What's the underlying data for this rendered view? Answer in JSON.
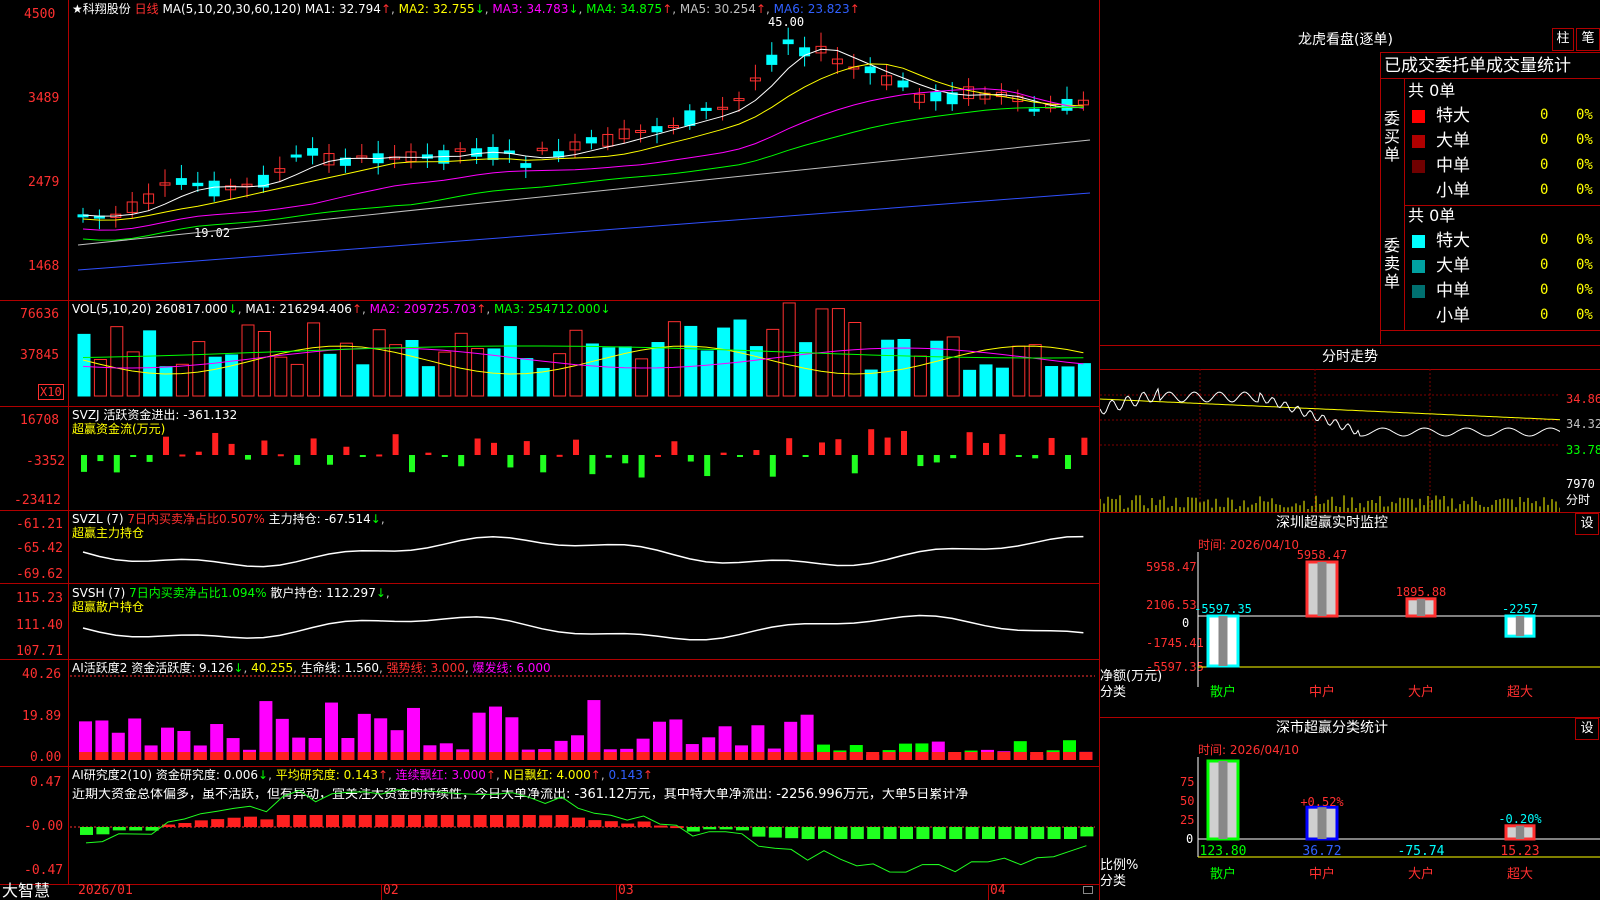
{
  "colors": {
    "up": "#ff3030",
    "down": "#00ffff",
    "grid": "#b00000",
    "ma1": "#ffffff",
    "ma2": "#ffff00",
    "ma3": "#ff00ff",
    "ma4": "#00ff00",
    "ma5": "#c0c0c0",
    "ma6": "#0000ff"
  },
  "main": {
    "star_name": "★科翔股份",
    "period": "日线",
    "ma_label": "MA(5,10,20,30,60,120)",
    "ma1": "MA1: 32.794",
    "ma2": "MA2: 32.755",
    "ma3": "MA3: 34.783",
    "ma4": "MA4: 34.875",
    "ma5": "MA5: 30.254",
    "ma6": "MA6: 23.823",
    "high_mark": "45.00",
    "low_mark": "19.02",
    "yaxis": [
      "4500",
      "3489",
      "2479",
      "1468"
    ]
  },
  "vol": {
    "title": "VOL(5,10,20)",
    "val": "260817.000",
    "ma1": "MA1: 216294.406",
    "ma2": "MA2: 209725.703",
    "ma3": "MA3: 254712.000",
    "yaxis": [
      "76636",
      "37845"
    ],
    "unit": "X10"
  },
  "svzj": {
    "line1": "SVZJ  活跃资金进出: -361.132",
    "line2": "超赢资金流(万元)",
    "yaxis": [
      "16708",
      "-3352",
      "-23412"
    ]
  },
  "svzl": {
    "l1": "SVZL (7)",
    "l2": "7日内买卖净占比0.507%",
    "l3": "主力持仓: -67.514",
    "line2": "超赢主力持仓",
    "yaxis": [
      "-61.21",
      "-65.42",
      "-69.62"
    ]
  },
  "svsh": {
    "l1": "SVSH (7)",
    "l2": "7日内买卖净占比1.094%",
    "l3": "散户持仓: 112.297",
    "line2": "超赢散户持仓",
    "yaxis": [
      "115.23",
      "111.40",
      "107.71"
    ]
  },
  "ai1": {
    "l1": "AI活跃度2 资金活跃度: 9.126",
    "l2": "40.255",
    "l3": "生命线: 1.560",
    "l4": "强势线: 3.000",
    "l5": "爆发线: 6.000",
    "yaxis": [
      "40.26",
      "19.89",
      "0.00"
    ]
  },
  "ai2": {
    "l1": "AI研究度2(10) 资金研究度: 0.006",
    "l2": "平均研究度: 0.143",
    "l3": "连续飘红: 3.000",
    "l4": "N日飘红: 4.000",
    "l5": "0.143",
    "comment": "近期大资金总体偏多，虽不活跃，但有异动，宜关注大资金的持续性，今日大单净流出: -361.12万元，其中特大单净流出: -2256.996万元，大单5日累计净",
    "yaxis": [
      "0.47",
      "-0.00",
      "-0.47"
    ]
  },
  "bottom": {
    "brand": "大智慧",
    "dates": [
      "2026/01",
      "02",
      "03",
      "04"
    ]
  },
  "lhkp": {
    "title": "龙虎看盘(逐单)",
    "btn_col": "柱",
    "btn_pen": "笔",
    "header": "已成交委托单成交量统计",
    "buy_label": "委买单",
    "sell_label": "委卖单",
    "buy_total": "共 0单",
    "sell_total": "共 0单",
    "buy_rows": [
      {
        "name": "特大",
        "val": "0",
        "pct": "0%",
        "color": "#ff0000"
      },
      {
        "name": "大单",
        "val": "0",
        "pct": "0%",
        "color": "#b00000"
      },
      {
        "name": "中单",
        "val": "0",
        "pct": "0%",
        "color": "#700000"
      },
      {
        "name": "小单",
        "val": "0",
        "pct": "0%",
        "color": "#000000"
      }
    ],
    "sell_rows": [
      {
        "name": "特大",
        "val": "0",
        "pct": "0%",
        "color": "#00ffff"
      },
      {
        "name": "大单",
        "val": "0",
        "pct": "0%",
        "color": "#00a0a0"
      },
      {
        "name": "中单",
        "val": "0",
        "pct": "0%",
        "color": "#007070"
      },
      {
        "name": "小单",
        "val": "0",
        "pct": "0%",
        "color": "#000000"
      }
    ]
  },
  "intraday": {
    "title": "分时走势",
    "yaxis": [
      "34.86",
      "34.32",
      "33.78"
    ],
    "vol_label": "7970",
    "fen": "分时"
  },
  "monitor": {
    "title": "深圳超赢实时监控",
    "btn": "设",
    "time": "时间: 2026/04/10",
    "yaxis": [
      "5958.47",
      "2106.53",
      "0",
      "-1745.41",
      "-5597.35"
    ],
    "ylabel": "净额(万元)",
    "xlabel": "分类",
    "categories": [
      "散户",
      "中户",
      "大户",
      "超大"
    ],
    "value_labels": [
      "-5597.35",
      "5958.47",
      "1895.88",
      "-2257"
    ]
  },
  "classify": {
    "title": "深市超赢分类统计",
    "btn": "设",
    "time": "时间: 2026/04/10",
    "yaxis": [
      "75",
      "50",
      "25",
      "0"
    ],
    "ylabel": "比例%",
    "xlabel": "分类",
    "categories": [
      "散户",
      "中户",
      "大户",
      "超大"
    ],
    "bottom_values": [
      "123.80",
      "36.72",
      "-75.74",
      "15.23"
    ],
    "top_labels": [
      "+0.52%",
      "-0.20%"
    ]
  },
  "chart_data": [
    {
      "type": "bar",
      "title": "深圳超赢实时监控",
      "ylabel": "净额(万元)",
      "xlabel": "分类",
      "categories": [
        "散户",
        "中户",
        "大户",
        "超大"
      ],
      "values": [
        -5597.35,
        5958.47,
        1895.88,
        -2257
      ],
      "ylim": [
        -5597.35,
        5958.47
      ]
    },
    {
      "type": "bar",
      "title": "深市超赢分类统计",
      "ylabel": "比例%",
      "xlabel": "分类",
      "categories": [
        "散户",
        "中户",
        "大户",
        "超大"
      ],
      "values": [
        123.8,
        36.72,
        -75.74,
        15.23
      ],
      "ylim": [
        0,
        90
      ]
    }
  ]
}
